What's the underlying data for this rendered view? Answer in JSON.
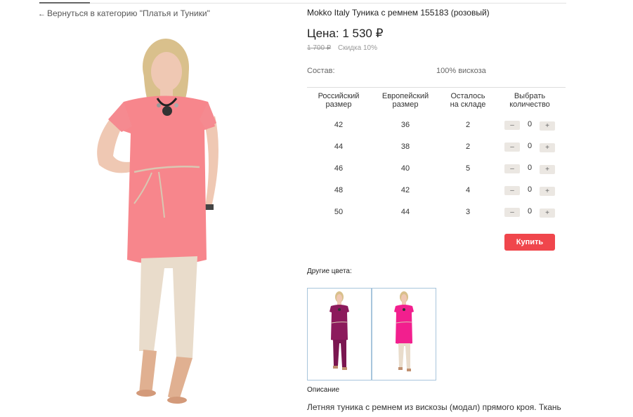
{
  "nav": {
    "back_arrow": "←",
    "back_label": "Вернуться в категорию \"Платья и Туники\""
  },
  "product": {
    "title": "Mokko Italy Туника с ремнем 155183 (розовый)",
    "price_label": "Цена: 1 530 ₽",
    "old_price": "1 700 ₽",
    "discount": "Скидка 10%",
    "composition_label": "Состав:",
    "composition_value": "100% вискоза"
  },
  "table": {
    "headers": [
      [
        "Российский",
        "размер"
      ],
      [
        "Европейский",
        "размер"
      ],
      [
        "Осталось",
        "на складе"
      ],
      [
        "Выбрать",
        "количество"
      ]
    ],
    "rows": [
      {
        "ru": "42",
        "eu": "36",
        "stock": "2",
        "qty": "0"
      },
      {
        "ru": "44",
        "eu": "38",
        "stock": "2",
        "qty": "0"
      },
      {
        "ru": "46",
        "eu": "40",
        "stock": "5",
        "qty": "0"
      },
      {
        "ru": "48",
        "eu": "42",
        "stock": "4",
        "qty": "0"
      },
      {
        "ru": "50",
        "eu": "44",
        "stock": "3",
        "qty": "0"
      }
    ],
    "minus_label": "–",
    "plus_label": "+"
  },
  "buy_label": "Купить",
  "other_colors_label": "Другие цвета:",
  "description_label": "Описание",
  "description_text": "Летняя туника с ремнем из вискозы (модал) прямого кроя. Ткань",
  "colors": {
    "accent": "#f0464c",
    "tunic_main": "#f7868c",
    "tunic_alt1": "#8c1a5c",
    "tunic_alt2": "#f21f8e",
    "pants_main": "#e9dccb",
    "thumb_border": "#a7c5dc"
  },
  "icons": [
    "back-arrow-icon",
    "minus-icon",
    "plus-icon"
  ]
}
